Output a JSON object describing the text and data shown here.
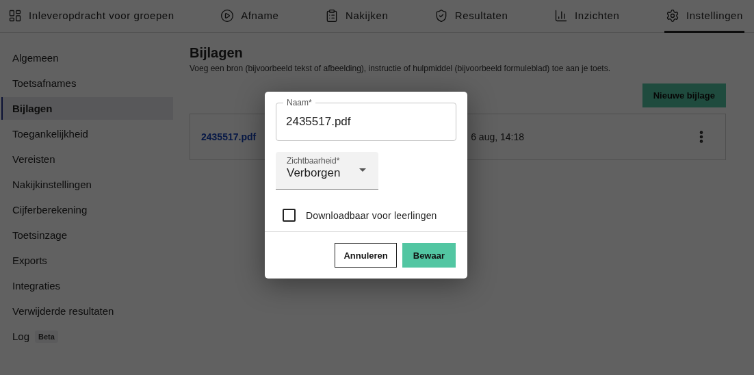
{
  "tabs": [
    {
      "label": "Inleveropdracht voor groepen",
      "selected": false
    },
    {
      "label": "Afname",
      "selected": false
    },
    {
      "label": "Nakijken",
      "selected": false
    },
    {
      "label": "Resultaten",
      "selected": false
    },
    {
      "label": "Inzichten",
      "selected": false
    },
    {
      "label": "Instellingen",
      "selected": true
    }
  ],
  "sidebar": {
    "items": [
      {
        "label": "Algemeen",
        "selected": false
      },
      {
        "label": "Toetsafnames",
        "selected": false
      },
      {
        "label": "Bijlagen",
        "selected": true
      },
      {
        "label": "Toegankelijkheid",
        "selected": false
      },
      {
        "label": "Vereisten",
        "selected": false
      },
      {
        "label": "Nakijkinstellingen",
        "selected": false
      },
      {
        "label": "Cijferberekening",
        "selected": false
      },
      {
        "label": "Toetsinzage",
        "selected": false
      },
      {
        "label": "Exports",
        "selected": false
      },
      {
        "label": "Integraties",
        "selected": false
      },
      {
        "label": "Verwijderde resultaten",
        "selected": false
      },
      {
        "label": "Log",
        "selected": false,
        "badge": "Beta"
      }
    ]
  },
  "main": {
    "title": "Bijlagen",
    "description": "Voeg een bron (bijvoorbeeld tekst of afbeelding), instructie of hulpmiddel (bijvoorbeeld formuleblad) toe aan je toets.",
    "new_button": "Nieuwe bijlage",
    "attachments": [
      {
        "name": "2435517.pdf",
        "date": "6 aug, 14:18"
      }
    ]
  },
  "dialog": {
    "name_field": {
      "label": "Naam*",
      "value": "2435517.pdf"
    },
    "visibility_select": {
      "label": "Zichtbaarheid*",
      "value": "Verborgen"
    },
    "checkbox": {
      "label": "Downloadbaar voor leerlingen",
      "checked": false
    },
    "cancel_button": "Annuleren",
    "save_button": "Bewaar"
  }
}
